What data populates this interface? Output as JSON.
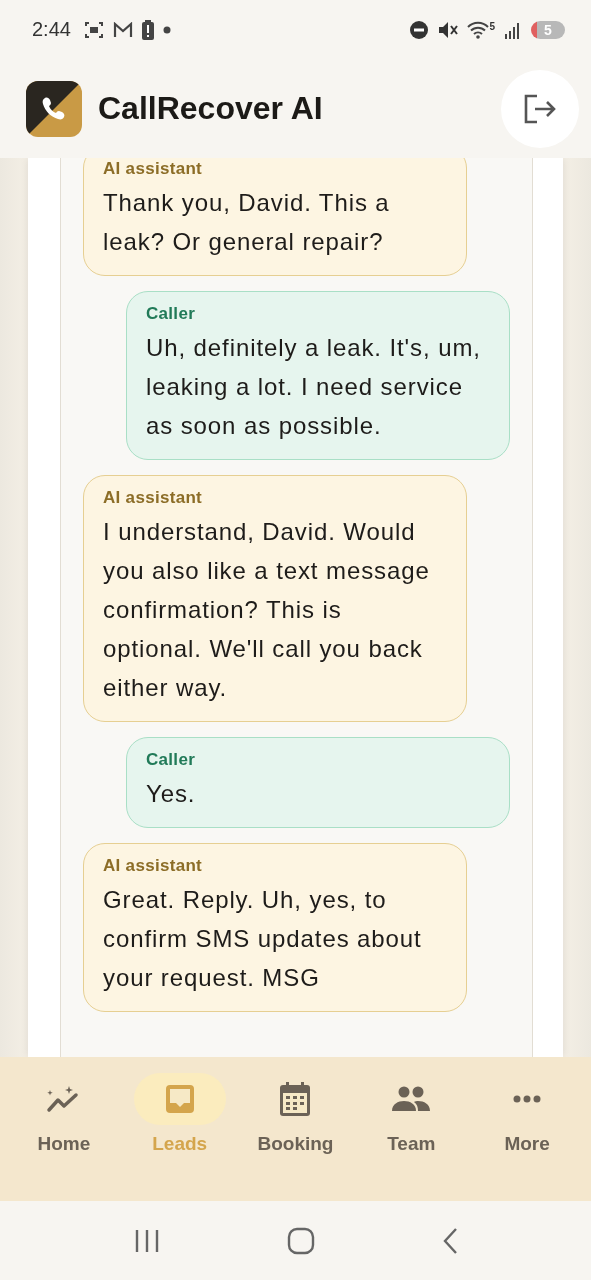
{
  "status_bar": {
    "time": "2:44",
    "wifi_badge": "5",
    "battery": "5"
  },
  "app_bar": {
    "title": "CallRecover AI"
  },
  "messages": [
    {
      "kind": "assistant",
      "label": "AI assistant",
      "text": "Thank you, David. This a leak? Or general repair?"
    },
    {
      "kind": "caller",
      "label": "Caller",
      "text": "Uh, definitely a leak. It's, um, leaking a lot. I need service as soon as possible."
    },
    {
      "kind": "assistant",
      "label": "AI assistant",
      "text": "I understand, David. Would you also like a text message confirmation? This is optional. We'll call you back either way."
    },
    {
      "kind": "caller",
      "label": "Caller",
      "text": "Yes."
    },
    {
      "kind": "assistant",
      "label": "AI assistant",
      "text": "Great. Reply. Uh, yes, to confirm SMS updates about your request. MSG"
    }
  ],
  "bottom_nav": [
    {
      "kind": "home",
      "label": "Home",
      "selected": false
    },
    {
      "kind": "leads",
      "label": "Leads",
      "selected": true
    },
    {
      "kind": "booking",
      "label": "Booking",
      "selected": false
    },
    {
      "kind": "team",
      "label": "Team",
      "selected": false
    },
    {
      "kind": "more",
      "label": "More",
      "selected": false
    }
  ]
}
